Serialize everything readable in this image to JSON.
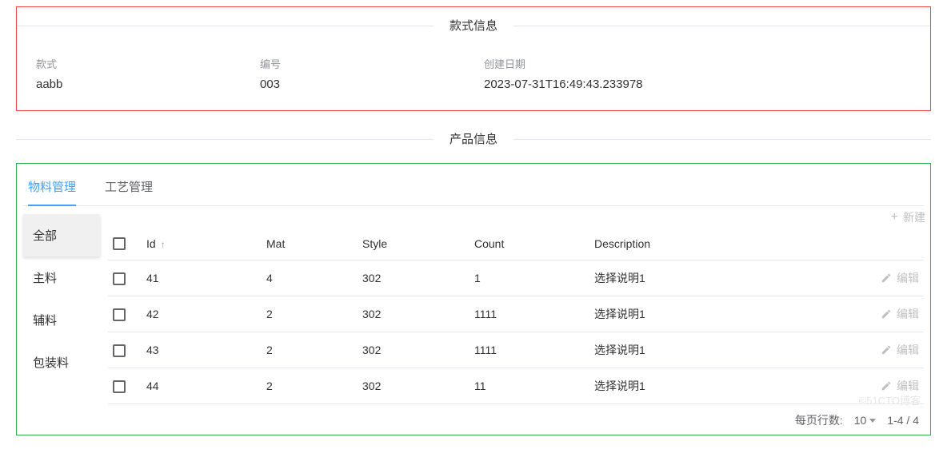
{
  "style_section": {
    "title": "款式信息",
    "fields": {
      "style_label": "款式",
      "style_value": "aabb",
      "code_label": "编号",
      "code_value": "003",
      "created_label": "创建日期",
      "created_value": "2023-07-31T16:49:43.233978"
    }
  },
  "product_section": {
    "title": "产品信息",
    "tabs": {
      "material": "物料管理",
      "process": "工艺管理"
    },
    "side_tabs": {
      "all": "全部",
      "main": "主料",
      "aux": "辅料",
      "pack": "包装料"
    },
    "create_label": "新建",
    "table": {
      "columns": {
        "id": "Id",
        "mat": "Mat",
        "style": "Style",
        "count": "Count",
        "description": "Description"
      },
      "sort_indicator": "↑",
      "edit_label": "编辑",
      "rows": [
        {
          "id": "41",
          "mat": "4",
          "style": "302",
          "count": "1",
          "description": "选择说明1"
        },
        {
          "id": "42",
          "mat": "2",
          "style": "302",
          "count": "1111",
          "description": "选择说明1"
        },
        {
          "id": "43",
          "mat": "2",
          "style": "302",
          "count": "1111",
          "description": "选择说明1"
        },
        {
          "id": "44",
          "mat": "2",
          "style": "302",
          "count": "11",
          "description": "选择说明1"
        }
      ]
    },
    "pager": {
      "page_size_label": "每页行数:",
      "page_size_value": "10",
      "range": "1-4 / 4"
    }
  }
}
